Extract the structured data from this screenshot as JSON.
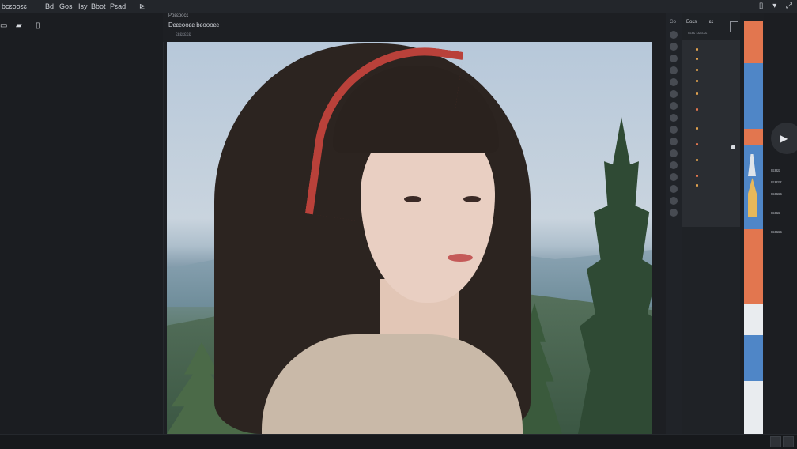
{
  "menu": {
    "items": [
      "bcɛooɛɛ",
      "Bd",
      "Gos",
      "Isy",
      "Bbot",
      "Pɛad"
    ],
    "right_icons": [
      "file-icon",
      "chevron-down-icon",
      "expand-icon"
    ]
  },
  "left_tools": [
    "file-icon",
    "folder-icon",
    "document-icon"
  ],
  "document": {
    "title": "Poɛɛoocɛ",
    "subtitle": "Dɛɛɛooɛɛ  bɛoooɛɛ",
    "info": "ɛɛɛɛɛɛɛ"
  },
  "layers": {
    "header_left": "Go",
    "header_mid": "Eoɛs",
    "header_right": "ɛɛ",
    "sub": "ɛɛɛɛ  ɛɛɛɛɛɛ"
  },
  "right_labels": [
    "ɛɛɛɛɛ",
    "ɛɛɛɛɛɛ",
    "ɛɛɛɛɛɛ",
    "ɛɛɛɛɛ",
    "ɛɛɛɛɛɛ"
  ],
  "colors": {
    "accent_orange": "#e2764f",
    "accent_blue": "#4f86c7",
    "swatch_white": "#e9ecef"
  }
}
